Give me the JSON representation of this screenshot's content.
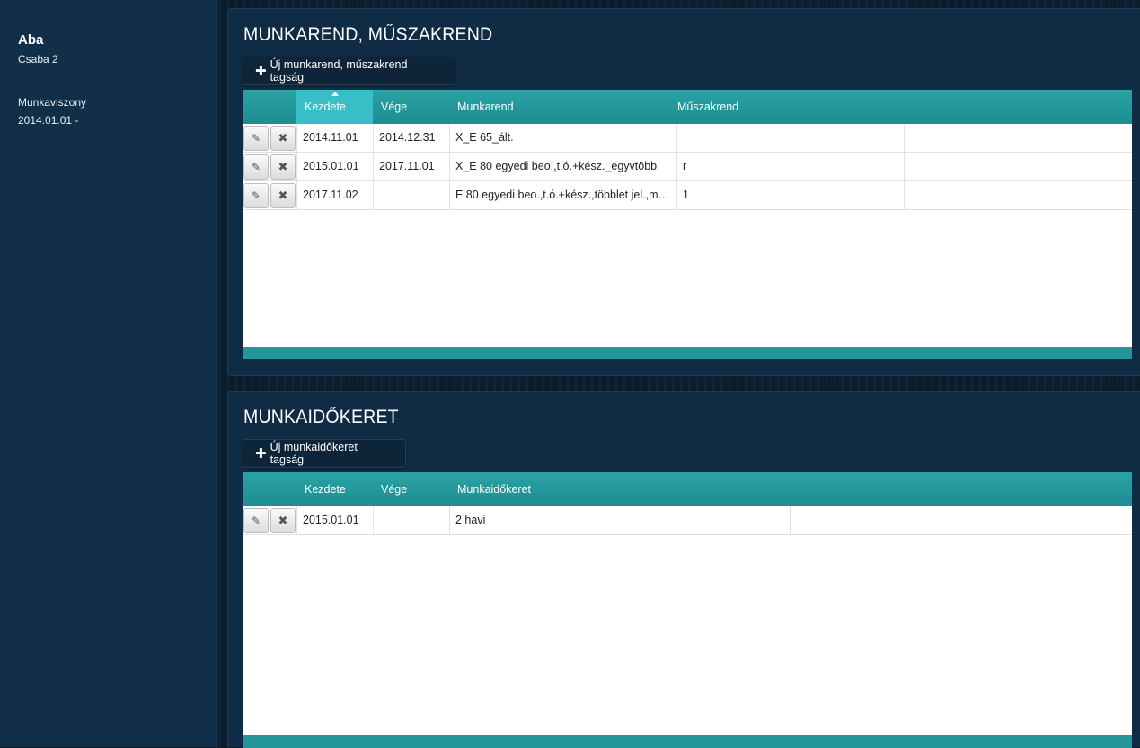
{
  "sidebar": {
    "name": "Aba",
    "subname": "Csaba 2",
    "employment_label": "Munkaviszony",
    "employment_value": "2014.01.01 -"
  },
  "schedule_panel": {
    "title": "MUNKAREND, MŰSZAKREND",
    "add_button": "Új munkarend, műszakrend tagság",
    "columns": [
      "Kezdete",
      "Vége",
      "Munkarend",
      "Műszakrend"
    ],
    "sorted_column": "Kezdete",
    "sort_direction": "ascending",
    "rows": [
      {
        "start": "2014.11.01",
        "end": "2014.12.31",
        "work_schedule": "X_E 65_ált.",
        "shift_schedule": ""
      },
      {
        "start": "2015.01.01",
        "end": "2017.11.01",
        "work_schedule": "X_E 80 egyedi beo.,t.ó.+kész._egyvtöbb",
        "shift_schedule": "r"
      },
      {
        "start": "2017.11.02",
        "end": "",
        "work_schedule": "E 80 egyedi beo.,t.ó.+kész.,többlet jel.,m…",
        "shift_schedule": "1"
      }
    ]
  },
  "timeframe_panel": {
    "title": "MUNKAIDŐKERET",
    "add_button": "Új munkaidőkeret tagság",
    "columns": [
      "Kezdete",
      "Vége",
      "Munkaidőkeret"
    ],
    "rows": [
      {
        "start": "2015.01.01",
        "end": "",
        "timeframe": "2 havi"
      }
    ]
  },
  "icons": {
    "edit": "pencil-icon",
    "delete": "x-icon",
    "add": "plus-icon"
  }
}
